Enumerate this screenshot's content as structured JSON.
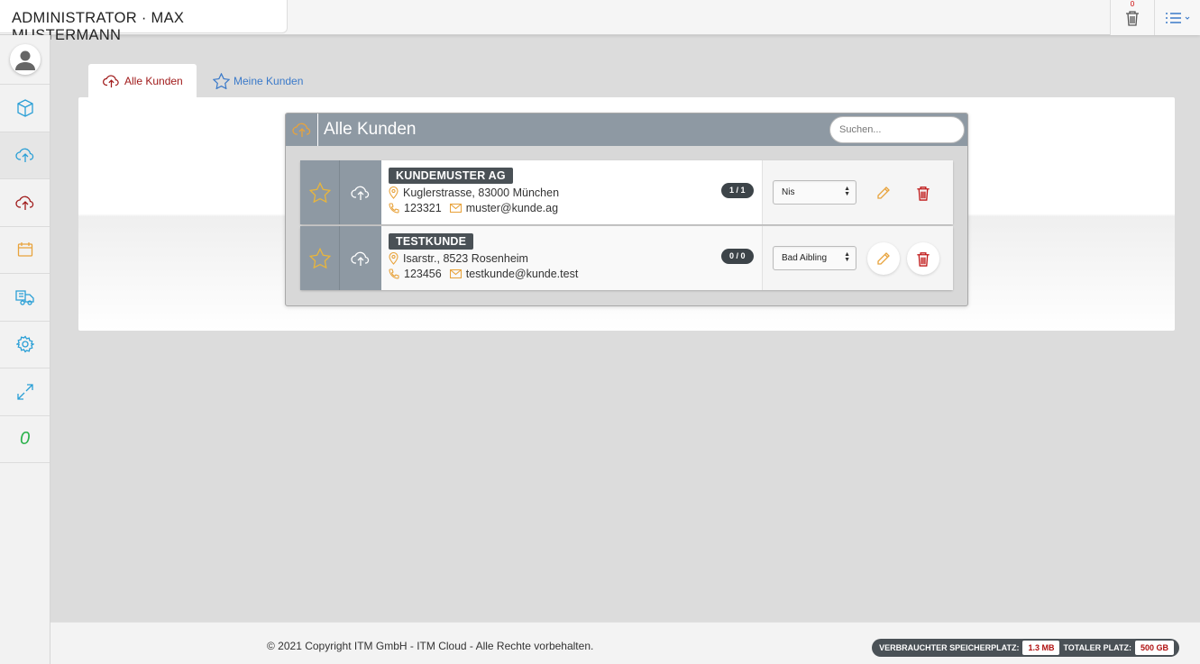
{
  "header": {
    "brand": "ADMINISTRATOR · MAX MUSTERMANN",
    "trash_count": "0"
  },
  "sidebar": {
    "items": [
      {
        "icon": "user-icon"
      },
      {
        "icon": "cube-icon"
      },
      {
        "icon": "cloud-upload-icon"
      },
      {
        "icon": "cloud-upload-icon"
      },
      {
        "icon": "calendar-icon"
      },
      {
        "icon": "truck-icon"
      },
      {
        "icon": "gear-icon"
      },
      {
        "icon": "expand-icon"
      }
    ],
    "counter": "0"
  },
  "tabs": [
    {
      "label": "Alle Kunden",
      "active": true
    },
    {
      "label": "Meine Kunden",
      "active": false
    }
  ],
  "list": {
    "title": "Alle Kunden",
    "search_placeholder": "Suchen...",
    "rows": [
      {
        "name": "KUNDEMUSTER AG",
        "address": "Kuglerstrasse, 83000 München",
        "phone": "123321",
        "email": "muster@kunde.ag",
        "count": "1 / 1",
        "select_value": "Nis"
      },
      {
        "name": "TESTKUNDE",
        "address": "Isarstr., 8523 Rosenheim",
        "phone": "123456",
        "email": "testkunde@kunde.test",
        "count": "0 / 0",
        "select_value": "Bad Aibling"
      }
    ]
  },
  "footer": {
    "copyright": "© 2021 Copyright ITM GmbH - ITM Cloud - Alle Rechte vorbehalten.",
    "used_label": "VERBRAUCHTER SPEICHERPLATZ:",
    "used_value": "1.3 MB",
    "total_label": "TOTALER PLATZ:",
    "total_value": "500 GB"
  },
  "colors": {
    "accent_red": "#a01a1a",
    "accent_blue": "#3b7ac9",
    "accent_orange": "#e8a33c",
    "header_gray": "#8e99a3",
    "counter_green": "#2bb24c"
  }
}
